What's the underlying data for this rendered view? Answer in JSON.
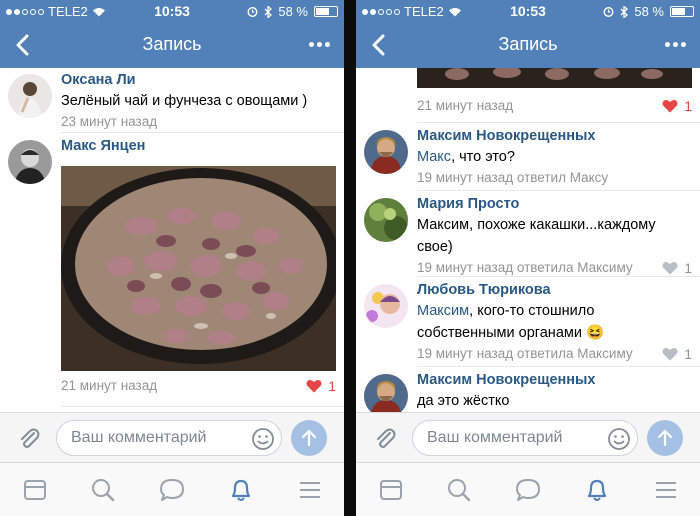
{
  "status": {
    "carrier": "TELE2",
    "time": "10:53",
    "battery": "58 %"
  },
  "nav": {
    "title": "Запись"
  },
  "left": {
    "comments": [
      {
        "name": "Оксана Ли",
        "text": "Зелёный чай и фунчеза с овощами )",
        "meta": "23 минут назад"
      },
      {
        "name": "Макс Янцен",
        "meta": "21 минут назад",
        "likes": "1"
      }
    ]
  },
  "right": {
    "top_meta": "21 минут назад",
    "top_likes": "1",
    "comments": [
      {
        "name": "Максим Новокрещенных",
        "mention": "Макс",
        "text": ", что это?",
        "meta": "19 минут назад ответил Максу"
      },
      {
        "name": "Мария Просто",
        "text": "Максим, похоже какашки...каждому свое)",
        "meta": "19 минут назад ответила Максиму",
        "likes": "1"
      },
      {
        "name": "Любовь Тюрикова",
        "mention": "Максим",
        "text": ", кого-то стошнило собственными органами",
        "emoji": "😆",
        "meta": "19 минут назад ответила Максиму",
        "likes": "1"
      },
      {
        "name": "Максим Новокрещенных",
        "text": "да это жёстко"
      }
    ]
  },
  "composer": {
    "placeholder": "Ваш комментарий"
  },
  "colors": {
    "header": "#5181b8",
    "link": "#2a5885",
    "like_active": "#e64646",
    "meta": "#939393"
  },
  "icons": [
    "back-chevron-icon",
    "more-dots-icon",
    "attach-icon",
    "smile-icon",
    "send-arrow-icon",
    "news-tab-icon",
    "search-tab-icon",
    "messages-tab-icon",
    "notifications-tab-icon",
    "menu-tab-icon"
  ]
}
